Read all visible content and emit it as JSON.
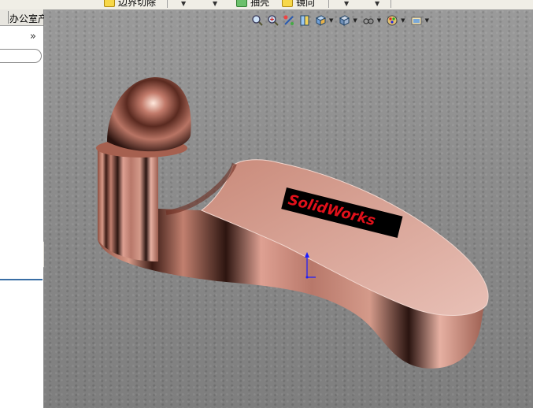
{
  "toolbar": {
    "items": [
      {
        "label": "边界切除",
        "icon": "boundary-cut-icon"
      },
      {
        "label": "抽壳",
        "icon": "shell-icon"
      },
      {
        "label": "镜向",
        "icon": "mirror-icon"
      }
    ]
  },
  "left_panel": {
    "tab_label": "办公室产品",
    "expand_glyph": "»"
  },
  "viewport": {
    "heads_up_toolbar": [
      "zoom-to-fit-icon",
      "zoom-to-area-icon",
      "previous-view-icon",
      "section-view-icon",
      "view-orientation-icon",
      "display-style-icon",
      "hide-show-items-icon",
      "edit-appearance-icon",
      "apply-scene-icon"
    ],
    "model_logo_text": "SolidWorks",
    "colors": {
      "model_copper": "#c98a7a",
      "logo_background": "#000000",
      "logo_text": "#e0101a",
      "background": "#8f8f8f"
    }
  }
}
